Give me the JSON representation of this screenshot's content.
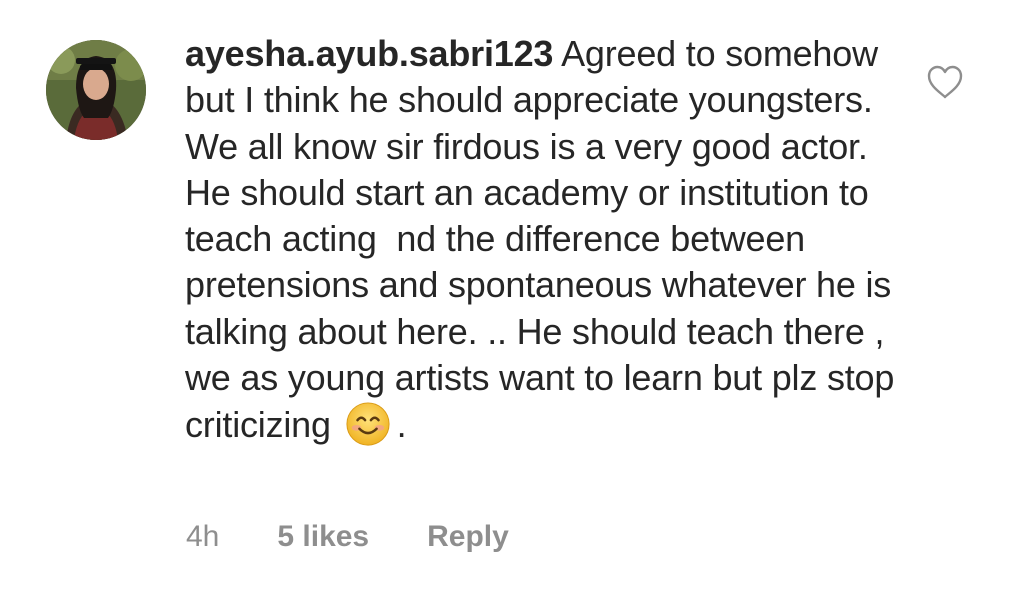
{
  "comment": {
    "username": "ayesha.ayub.sabri123",
    "text_before_emoji": "Agreed to somehow but I think he should appreciate youngsters. We all know sir firdous is a very good actor. He should start an academy or institution to teach acting  nd the difference between pretensions and spontaneous whatever he is talking about here. .. He should teach there , we as young artists want to learn but plz stop criticizing",
    "emoji": "smiling-face-icon",
    "text_after_emoji": ".",
    "time": "4h",
    "likes": "5 likes",
    "reply_label": "Reply"
  },
  "icons": {
    "like": "heart-outline-icon",
    "avatar": "user-avatar"
  },
  "colors": {
    "text": "#262626",
    "meta": "#8e8e8e",
    "emoji_face": "#f7c532"
  }
}
